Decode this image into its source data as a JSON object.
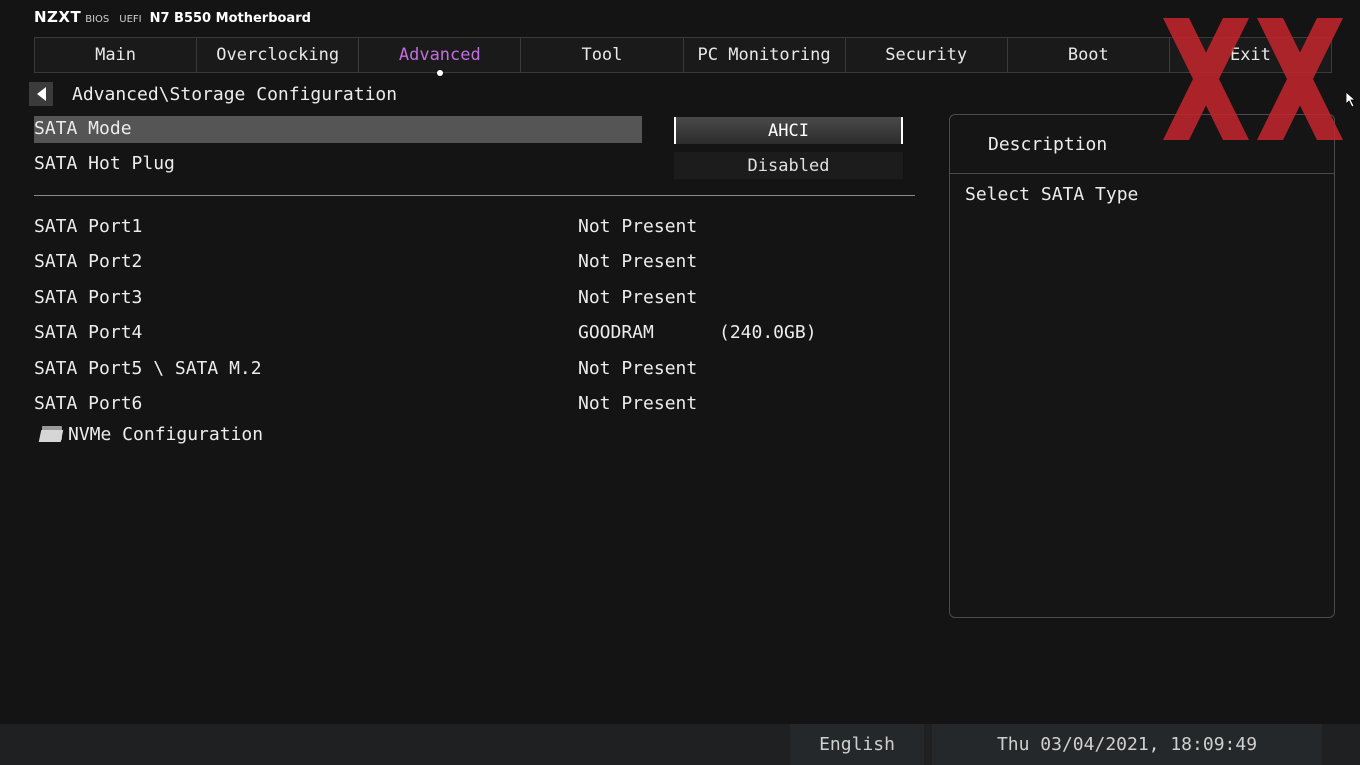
{
  "brand": {
    "logo": "NZXT",
    "bios": "BIOS",
    "uefi": "UEFI",
    "board": "N7 B550 Motherboard"
  },
  "tabs": [
    {
      "label": "Main"
    },
    {
      "label": "Overclocking"
    },
    {
      "label": "Advanced",
      "active": true
    },
    {
      "label": "Tool"
    },
    {
      "label": "PC Monitoring"
    },
    {
      "label": "Security"
    },
    {
      "label": "Boot"
    },
    {
      "label": "Exit"
    }
  ],
  "breadcrumb": "Advanced\\Storage Configuration",
  "settings": {
    "sata_mode": {
      "label": "SATA Mode",
      "value": "AHCI"
    },
    "sata_hot_plug": {
      "label": "SATA Hot Plug",
      "value": "Disabled"
    }
  },
  "ports": [
    {
      "label": "SATA Port1",
      "value": "Not Present",
      "capacity": ""
    },
    {
      "label": "SATA Port2",
      "value": "Not Present",
      "capacity": ""
    },
    {
      "label": "SATA Port3",
      "value": "Not Present",
      "capacity": ""
    },
    {
      "label": "SATA Port4",
      "value": "GOODRAM",
      "capacity": "(240.0GB)"
    },
    {
      "label": "SATA Port5 \\ SATA M.2",
      "value": "Not Present",
      "capacity": ""
    },
    {
      "label": "SATA Port6",
      "value": "Not Present",
      "capacity": ""
    }
  ],
  "submenu": {
    "label": "NVMe Configuration",
    "icon": "folder-icon"
  },
  "description": {
    "title": "Description",
    "text": "Select SATA Type"
  },
  "footer": {
    "language": "English",
    "datetime": "Thu 03/04/2021, 18:09:49"
  },
  "colors": {
    "active_tab": "#c26ee0",
    "watermark": "#c0262d",
    "background": "#141414"
  }
}
